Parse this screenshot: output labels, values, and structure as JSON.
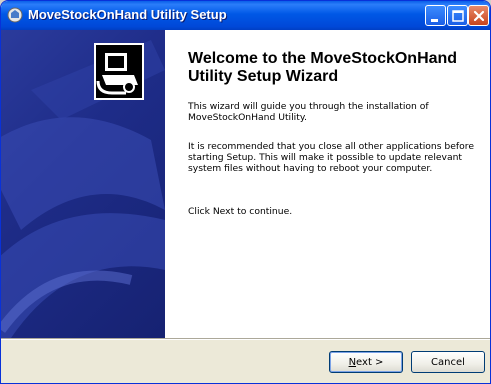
{
  "window": {
    "title": "MoveStockOnHand Utility Setup"
  },
  "welcome": {
    "heading": "Welcome to the MoveStockOnHand Utility Setup Wizard",
    "paragraph1": "This wizard will guide you through the installation of MoveStockOnHand Utility.",
    "paragraph2": "It is recommended that you close all other applications before starting Setup. This will make it possible to update relevant system files without having to reboot your computer.",
    "paragraph3": "Click Next to continue."
  },
  "buttons": {
    "next_mnemonic": "N",
    "next_rest": "ext >",
    "cancel": "Cancel"
  },
  "colors": {
    "titlebar": "#0058e6",
    "banner": "#1e2c88",
    "close_button": "#c8441c"
  }
}
